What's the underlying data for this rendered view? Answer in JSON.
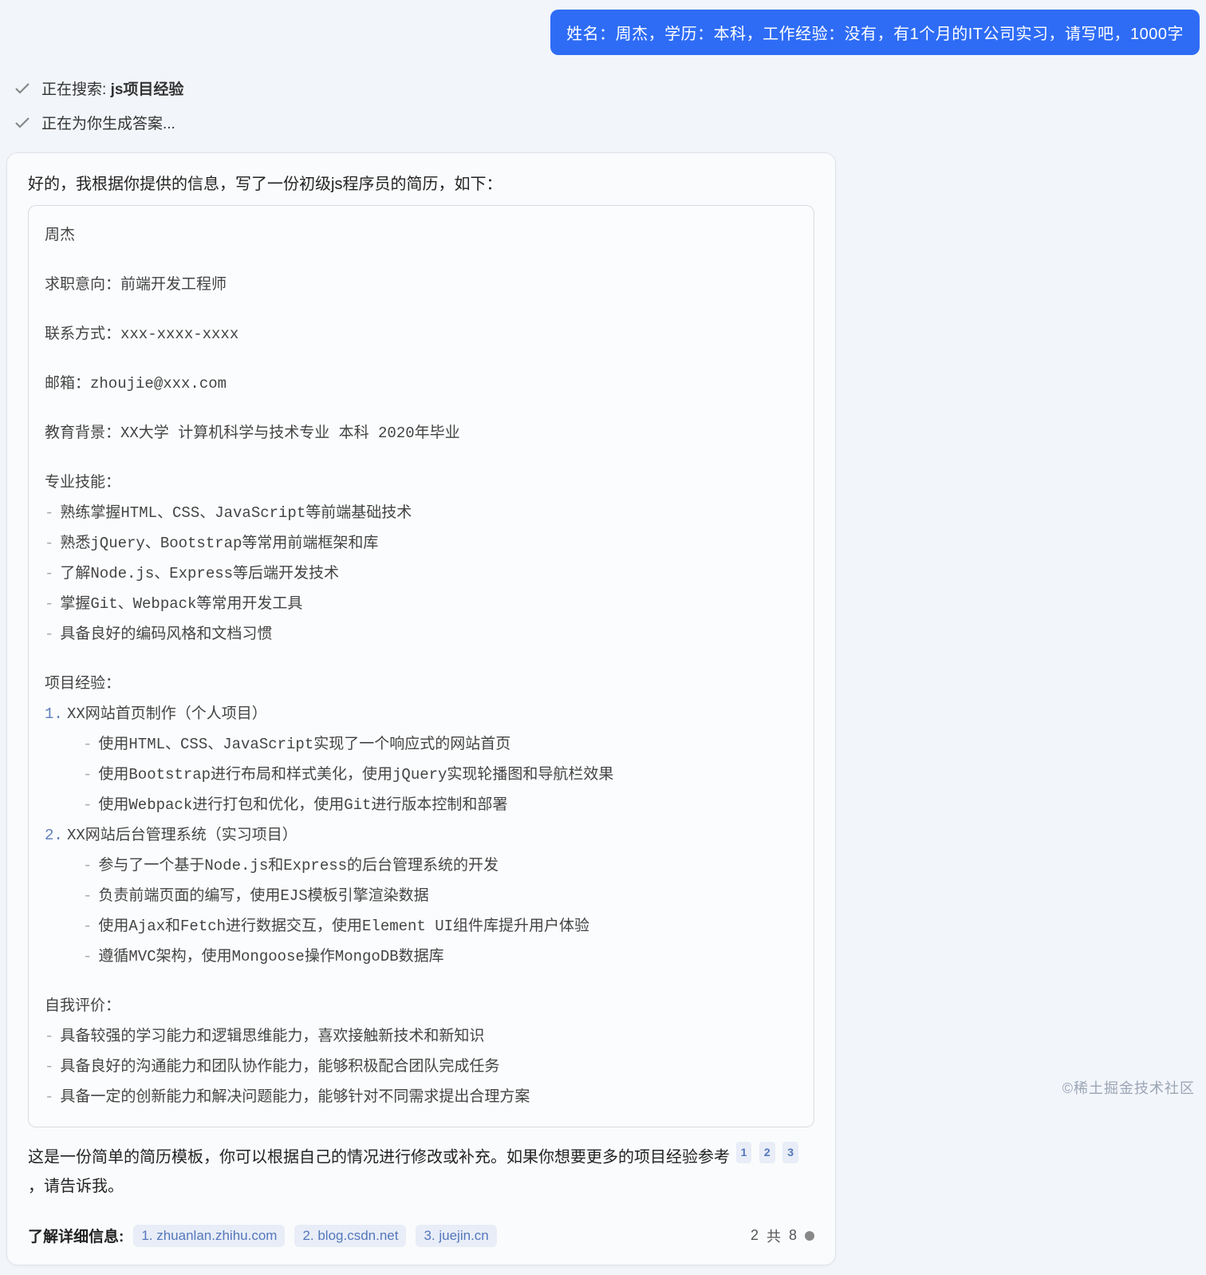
{
  "user_prompt": "姓名：周杰，学历：本科，工作经验：没有，有1个月的IT公司实习，请写吧，1000字",
  "status": {
    "searching_prefix": "正在搜索: ",
    "searching_term": "js项目经验",
    "generating": "正在为你生成答案..."
  },
  "assistant": {
    "intro": "好的，我根据你提供的信息，写了一份初级js程序员的简历，如下：",
    "resume": {
      "name": "周杰",
      "target": "求职意向：前端开发工程师",
      "contact": "联系方式：xxx-xxxx-xxxx",
      "email": "邮箱：zhoujie@xxx.com",
      "education": "教育背景：XX大学 计算机科学与技术专业 本科 2020年毕业",
      "skills_header": "专业技能：",
      "skills": [
        "熟练掌握HTML、CSS、JavaScript等前端基础技术",
        "熟悉jQuery、Bootstrap等常用前端框架和库",
        "了解Node.js、Express等后端开发技术",
        "掌握Git、Webpack等常用开发工具",
        "具备良好的编码风格和文档习惯"
      ],
      "projects_header": "项目经验：",
      "projects": [
        {
          "title": "XX网站首页制作（个人项目）",
          "details": [
            "使用HTML、CSS、JavaScript实现了一个响应式的网站首页",
            "使用Bootstrap进行布局和样式美化，使用jQuery实现轮播图和导航栏效果",
            "使用Webpack进行打包和优化，使用Git进行版本控制和部署"
          ]
        },
        {
          "title": "XX网站后台管理系统（实习项目）",
          "details": [
            "参与了一个基于Node.js和Express的后台管理系统的开发",
            "负责前端页面的编写，使用EJS模板引擎渲染数据",
            "使用Ajax和Fetch进行数据交互，使用Element UI组件库提升用户体验",
            "遵循MVC架构，使用Mongoose操作MongoDB数据库"
          ]
        }
      ],
      "self_eval_header": "自我评价：",
      "self_eval": [
        "具备较强的学习能力和逻辑思维能力，喜欢接触新技术和新知识",
        "具备良好的沟通能力和团队协作能力，能够积极配合团队完成任务",
        "具备一定的创新能力和解决问题能力，能够针对不同需求提出合理方案"
      ]
    },
    "outro_part1": "这是一份简单的简历模板，你可以根据自己的情况进行修改或补充。如果你想要更多的项目经验参考",
    "outro_part2": "，请告诉我。",
    "citations": [
      "1",
      "2",
      "3"
    ]
  },
  "footer": {
    "info_label": "了解详细信息:",
    "links": [
      "1. zhuanlan.zhihu.com",
      "2. blog.csdn.net",
      "3. juejin.cn"
    ],
    "page_current": "2",
    "page_sep": "共",
    "page_total": "8"
  },
  "watermark": "©稀土掘金技术社区"
}
